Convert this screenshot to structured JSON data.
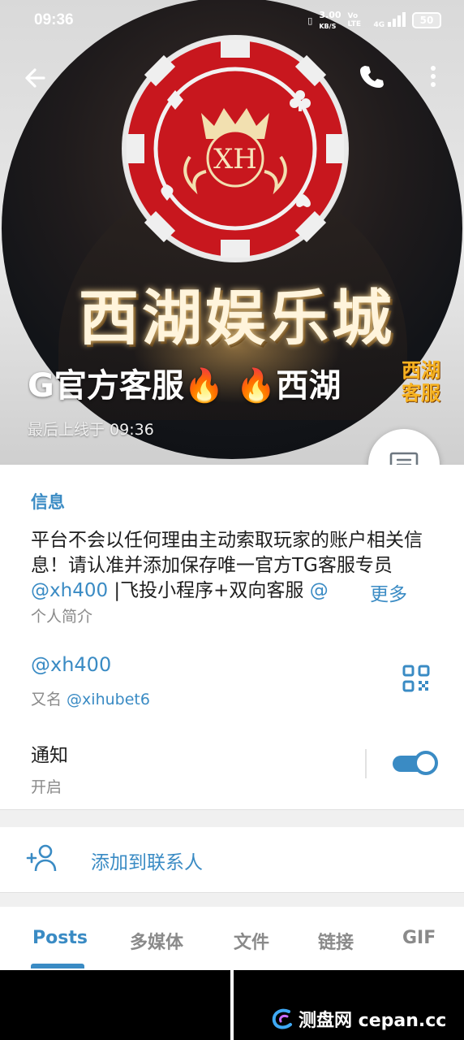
{
  "statusbar": {
    "time": "09:36",
    "net_speed": "3.00",
    "net_unit": "KB/S",
    "volte": "Vo LTE",
    "signal": "4G",
    "battery": "50"
  },
  "header": {
    "avatar_brand_text": "西湖娱乐城",
    "avatar_logo_text": "XH",
    "name": "G官方客服🔥 🔥西湖",
    "corner_badge": "西湖客服",
    "last_seen": "最后上线于 09:36"
  },
  "info": {
    "title": "信息",
    "bio_text": "平台不会以任何理由主动索取玩家的账户相关信息！请认准并添加保存唯一官方TG客服专员 ",
    "bio_link": "@xh400",
    "bio_tail": " |飞投小程序+双向客服 ",
    "bio_at": "@",
    "bio_more": "更多",
    "bio_label": "个人简介",
    "username": "@xh400",
    "alias_prefix": "又名 ",
    "alias_link": "@xihubet6",
    "notifications_label": "通知",
    "notifications_state": "开启",
    "notifications_on": true
  },
  "actions": {
    "add_contact": "添加到联系人"
  },
  "tabs": [
    {
      "label": "Posts",
      "active": true
    },
    {
      "label": "多媒体",
      "active": false
    },
    {
      "label": "文件",
      "active": false
    },
    {
      "label": "链接",
      "active": false
    },
    {
      "label": "GIF",
      "active": false
    }
  ],
  "watermark": "测盘网 cepan.cc",
  "colors": {
    "accent": "#3a8bc4",
    "chip_red": "#c8171e",
    "brand_gold": "#f7b321"
  }
}
